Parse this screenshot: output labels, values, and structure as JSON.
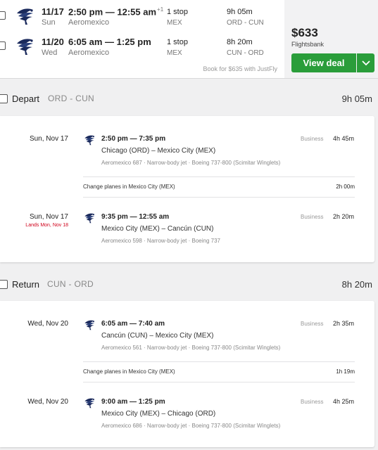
{
  "summary": {
    "legs": [
      {
        "date": "11/17",
        "day": "Sun",
        "times": "2:50 pm — 12:55 am",
        "plus": "+1",
        "airline": "Aeromexico",
        "stops": "1 stop",
        "stop_city": "MEX",
        "duration": "9h 05m",
        "route": "ORD - CUN"
      },
      {
        "date": "11/20",
        "day": "Wed",
        "times": "6:05 am — 1:25 pm",
        "plus": "",
        "airline": "Aeromexico",
        "stops": "1 stop",
        "stop_city": "MEX",
        "duration": "8h 20m",
        "route": "CUN - ORD"
      }
    ],
    "book_alt": "Book for $635 with JustFly",
    "price": "$633",
    "provider": "Flightsbank",
    "deal_button": "View deal"
  },
  "depart": {
    "title": "Depart",
    "route": "ORD - CUN",
    "duration": "9h 05m",
    "segments": [
      {
        "date": "Sun, Nov 17",
        "lands": "",
        "time": "2:50 pm — 7:35 pm",
        "cities": "Chicago (ORD) – Mexico City (MEX)",
        "info": "Aeromexico 687 · Narrow-body jet · Boeing 737-800 (Scimitar Winglets)",
        "class": "Business",
        "duration": "4h 45m"
      },
      {
        "date": "Sun, Nov 17",
        "lands": "Lands Mon, Nov 18",
        "time": "9:35 pm — 12:55 am",
        "cities": "Mexico City (MEX) – Cancún (CUN)",
        "info": "Aeromexico 598 · Narrow-body jet · Boeing 737",
        "class": "Business",
        "duration": "2h 20m"
      }
    ],
    "layover": {
      "text": "Change planes in Mexico City (MEX)",
      "duration": "2h 00m"
    }
  },
  "return": {
    "title": "Return",
    "route": "CUN - ORD",
    "duration": "8h 20m",
    "segments": [
      {
        "date": "Wed, Nov 20",
        "lands": "",
        "time": "6:05 am — 7:40 am",
        "cities": "Cancún (CUN) – Mexico City (MEX)",
        "info": "Aeromexico 561 · Narrow-body jet · Boeing 737-800 (Scimitar Winglets)",
        "class": "Business",
        "duration": "2h 35m"
      },
      {
        "date": "Wed, Nov 20",
        "lands": "",
        "time": "9:00 am — 1:25 pm",
        "cities": "Mexico City (MEX) – Chicago (ORD)",
        "info": "Aeromexico 686 · Narrow-body jet · Boeing 737-800 (Scimitar Winglets)",
        "class": "Business",
        "duration": "4h 25m"
      }
    ],
    "layover": {
      "text": "Change planes in Mexico City (MEX)",
      "duration": "1h 19m"
    }
  },
  "icons": {
    "airline_logo": "aeromexico-eagle-icon",
    "caret": "chevron-down-icon",
    "checkbox": "checkbox-icon"
  },
  "colors": {
    "accent_green": "#2a9d3a",
    "lands_red": "#d0021b",
    "logo_blue": "#1b2a5c"
  }
}
